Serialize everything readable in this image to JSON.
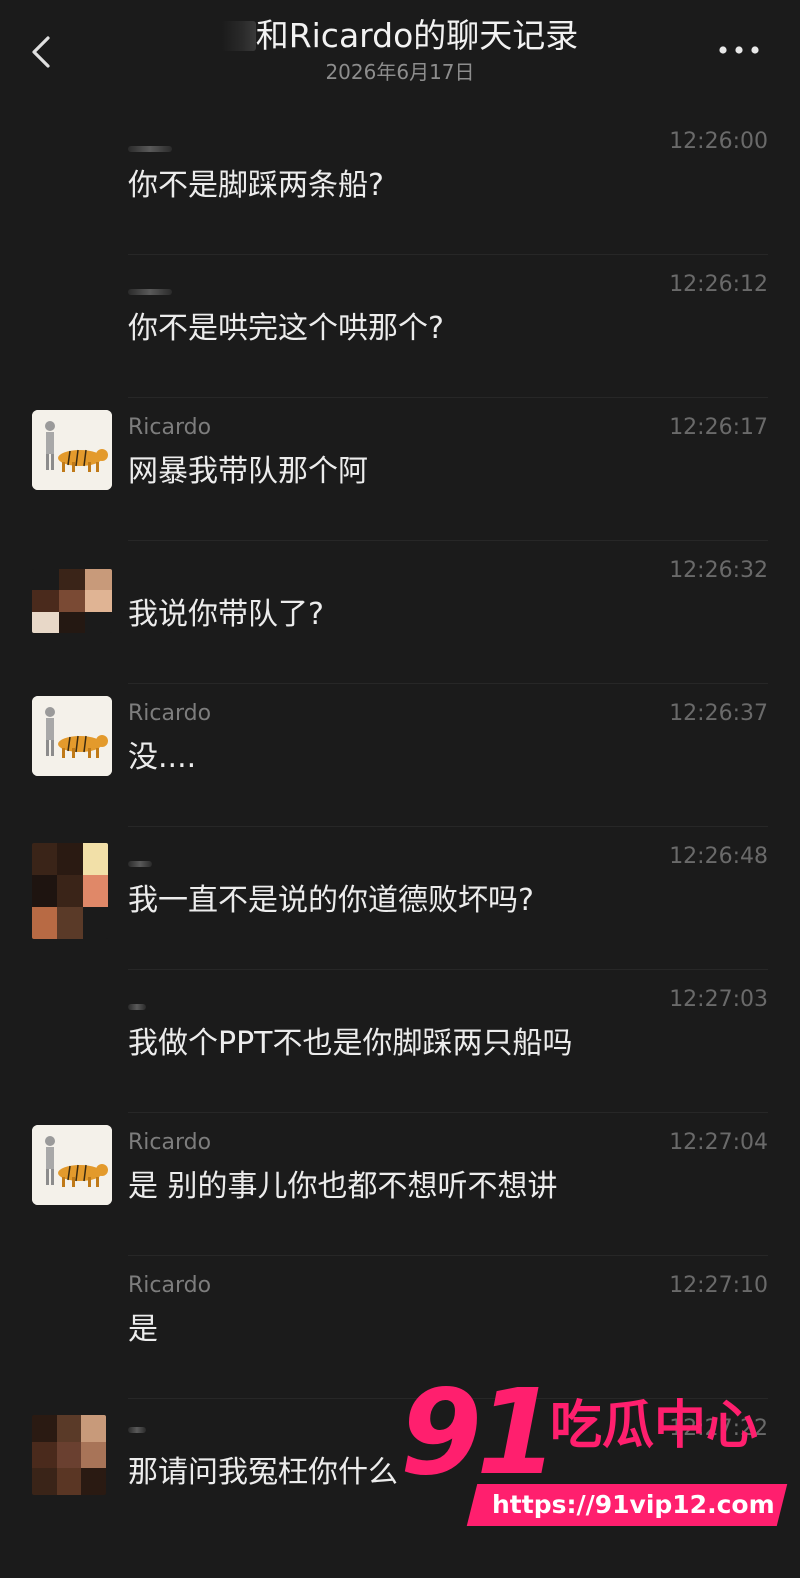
{
  "header": {
    "title": "和Ricardo的聊天记录",
    "date": "2026年6月17日"
  },
  "messages": [
    {
      "sender": "",
      "time": "12:26:00",
      "text": "你不是脚踩两条船?"
    },
    {
      "sender": "",
      "time": "12:26:12",
      "text": "你不是哄完这个哄那个?"
    },
    {
      "sender": "Ricardo",
      "time": "12:26:17",
      "text": "网暴我带队那个阿"
    },
    {
      "sender": "",
      "time": "12:26:32",
      "text": "我说你带队了?"
    },
    {
      "sender": "Ricardo",
      "time": "12:26:37",
      "text": "没...."
    },
    {
      "sender": "",
      "time": "12:26:48",
      "text": "我一直不是说的你道德败坏吗?"
    },
    {
      "sender": "",
      "time": "12:27:03",
      "text": "我做个PPT不也是你脚踩两只船吗"
    },
    {
      "sender": "Ricardo",
      "time": "12:27:04",
      "text": "是 别的事儿你也都不想听不想讲"
    },
    {
      "sender": "Ricardo",
      "time": "12:27:10",
      "text": "是"
    },
    {
      "sender": "",
      "time": "12:27:22",
      "text": "那请问我冤枉你什么"
    }
  ],
  "watermark": {
    "number": "91",
    "name": "吃瓜中心",
    "url": "https://91vip12.com"
  },
  "colors": {
    "background": "#1b1b1b",
    "watermark": "#ff1f6e"
  }
}
